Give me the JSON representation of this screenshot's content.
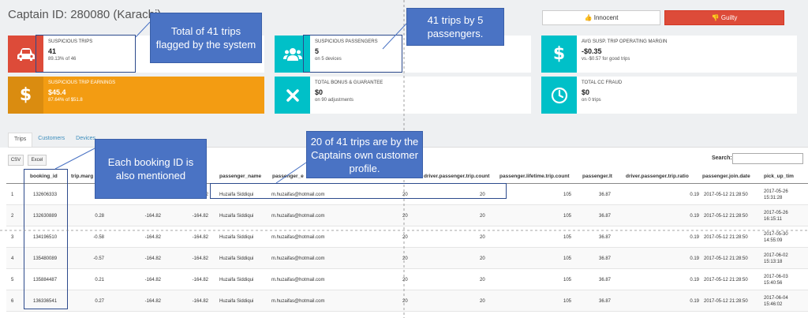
{
  "header": {
    "title": "Captain ID: 280080 (Karachi)"
  },
  "actions": {
    "innocent": "Innocent",
    "guilty": "Guilty"
  },
  "cards": {
    "suspicious_trips": {
      "label": "SUSPICIOUS TRIPS",
      "value": "41",
      "sub": "89.13% of 46"
    },
    "suspicious_passengers": {
      "label": "SUSPICIOUS PASSENGERS",
      "value": "5",
      "sub": "on 5 devices"
    },
    "avg_margin": {
      "label": "AVG SUSP. TRIP OPERATING MARGIN",
      "value": "-$0.35",
      "sub": "vs.-$0.57 for good trips"
    },
    "earnings": {
      "label": "SUSPICIOUS TRIP EARNINGS",
      "value": "$45.4",
      "sub": "87.64% of $51.8"
    },
    "bonus": {
      "label": "TOTAL BONUS & GUARANTEE",
      "value": "$0",
      "sub": "on 90 adjustments"
    },
    "cc_fraud": {
      "label": "TOTAL CC FRAUD",
      "value": "$0",
      "sub": "on 0 trips"
    }
  },
  "tabs": [
    "Trips",
    "Customers",
    "Devices"
  ],
  "table_controls": {
    "csv": "CSV",
    "excel": "Excel",
    "search_label": "Search:",
    "search_value": ""
  },
  "table": {
    "headers": [
      "booking_id",
      "trip.marg",
      "passenger_name",
      "passenger_e",
      "driver.passenger.trip.count",
      "passenger.lifetime.trip.count",
      "passenger.lt",
      "driver.passenger.trip.ratio",
      "passenger.join.date",
      "pick_up_tim"
    ],
    "rows": [
      {
        "idx": "1",
        "booking_id": "132606333",
        "margin": "",
        "c3": "",
        "c4": "2",
        "name": "Huzaifa Siddiqui",
        "email": "m.huzaifas@hotmail.com",
        "dpc": "20",
        "dpc2": "20",
        "lifetime": "105",
        "lt": "36.87",
        "ratio": "0.19",
        "join": "2017-05-12 21:28:50",
        "pickup_date": "2017-05-26",
        "pickup_time": "15:31:28"
      },
      {
        "idx": "2",
        "booking_id": "132630889",
        "margin": "0.28",
        "c3": "-164.82",
        "c4": "-164.82",
        "name": "Huzaifa Siddiqui",
        "email": "m.huzaifas@hotmail.com",
        "dpc": "20",
        "dpc2": "20",
        "lifetime": "105",
        "lt": "36.87",
        "ratio": "0.19",
        "join": "2017-05-12 21:28:50",
        "pickup_date": "2017-05-26",
        "pickup_time": "16:15:11"
      },
      {
        "idx": "3",
        "booking_id": "134196510",
        "margin": "-0.58",
        "c3": "-164.82",
        "c4": "-164.82",
        "name": "Huzaifa Siddiqui",
        "email": "m.huzaifas@hotmail.com",
        "dpc": "20",
        "dpc2": "20",
        "lifetime": "105",
        "lt": "36.87",
        "ratio": "0.19",
        "join": "2017-05-12 21:28:50",
        "pickup_date": "2017-05-30",
        "pickup_time": "14:55:09"
      },
      {
        "idx": "4",
        "booking_id": "135480089",
        "margin": "-0.57",
        "c3": "-164.82",
        "c4": "-164.82",
        "name": "Huzaifa Siddiqui",
        "email": "m.huzaifas@hotmail.com",
        "dpc": "20",
        "dpc2": "20",
        "lifetime": "105",
        "lt": "36.87",
        "ratio": "0.19",
        "join": "2017-05-12 21:28:50",
        "pickup_date": "2017-06-02",
        "pickup_time": "15:13:18"
      },
      {
        "idx": "5",
        "booking_id": "135884487",
        "margin": "0.21",
        "c3": "-164.82",
        "c4": "-164.82",
        "name": "Huzaifa Siddiqui",
        "email": "m.huzaifas@hotmail.com",
        "dpc": "20",
        "dpc2": "20",
        "lifetime": "105",
        "lt": "36.87",
        "ratio": "0.19",
        "join": "2017-05-12 21:28:50",
        "pickup_date": "2017-06-03",
        "pickup_time": "15:40:56"
      },
      {
        "idx": "6",
        "booking_id": "136336541",
        "margin": "0.27",
        "c3": "-164.82",
        "c4": "-164.82",
        "name": "Huzaifa Siddiqui",
        "email": "m.huzaifas@hotmail.com",
        "dpc": "20",
        "dpc2": "20",
        "lifetime": "105",
        "lt": "36.87",
        "ratio": "0.19",
        "join": "2017-05-12 21:28:50",
        "pickup_date": "2017-06-04",
        "pickup_time": "15:46:02"
      }
    ]
  },
  "callouts": {
    "trips_flagged": "Total of 41 trips flagged by the system",
    "passengers": "41 trips by 5 passengers.",
    "booking": "Each booking ID is also mentioned",
    "own_profile": "20 of 41 trips are by the Captains own customer profile."
  },
  "icons": {
    "car": "car-icon",
    "users": "users-icon",
    "dollar": "dollar-icon",
    "close": "close-icon",
    "clock": "clock-icon",
    "thumbs_up": "thumbs-up-icon",
    "thumbs_down": "thumbs-down-icon"
  },
  "colors": {
    "red": "#dd4b39",
    "teal": "#00c0c8",
    "orange": "#f39c12",
    "callout": "#4a73c4"
  }
}
